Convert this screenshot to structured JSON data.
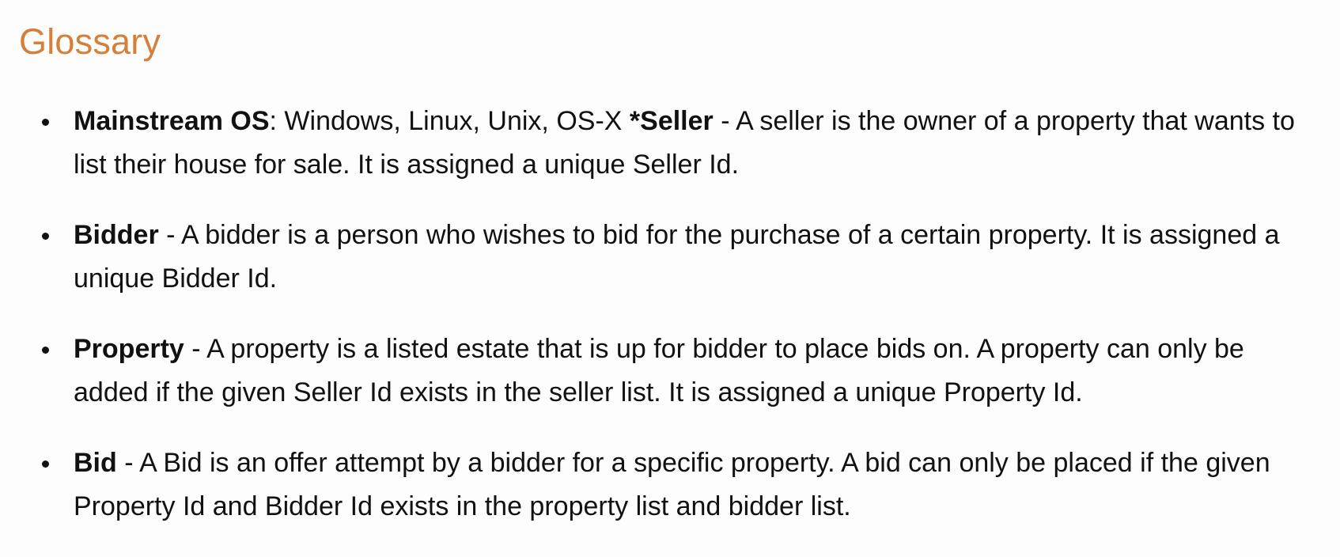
{
  "heading": "Glossary",
  "items": [
    {
      "term": "Mainstream OS",
      "desc": ": Windows, Linux, Unix, OS-X ",
      "term2": "*Seller",
      "desc2": " - A seller is the owner of a property that wants to list their house for sale. It is assigned a unique Seller Id."
    },
    {
      "term": "Bidder",
      "desc": " - A bidder is a person who wishes to bid for the purchase of a certain property. It is assigned a unique Bidder Id."
    },
    {
      "term": "Property",
      "desc": " - A property is a listed estate that is up for bidder to place bids on. A property can only be added if the given Seller Id exists in the seller list. It is assigned a unique Property Id."
    },
    {
      "term": "Bid",
      "desc": " - A Bid is an offer attempt by a bidder for a specific property. A bid can only be placed if the given Property Id and Bidder Id exists in the property list and bidder list."
    }
  ]
}
